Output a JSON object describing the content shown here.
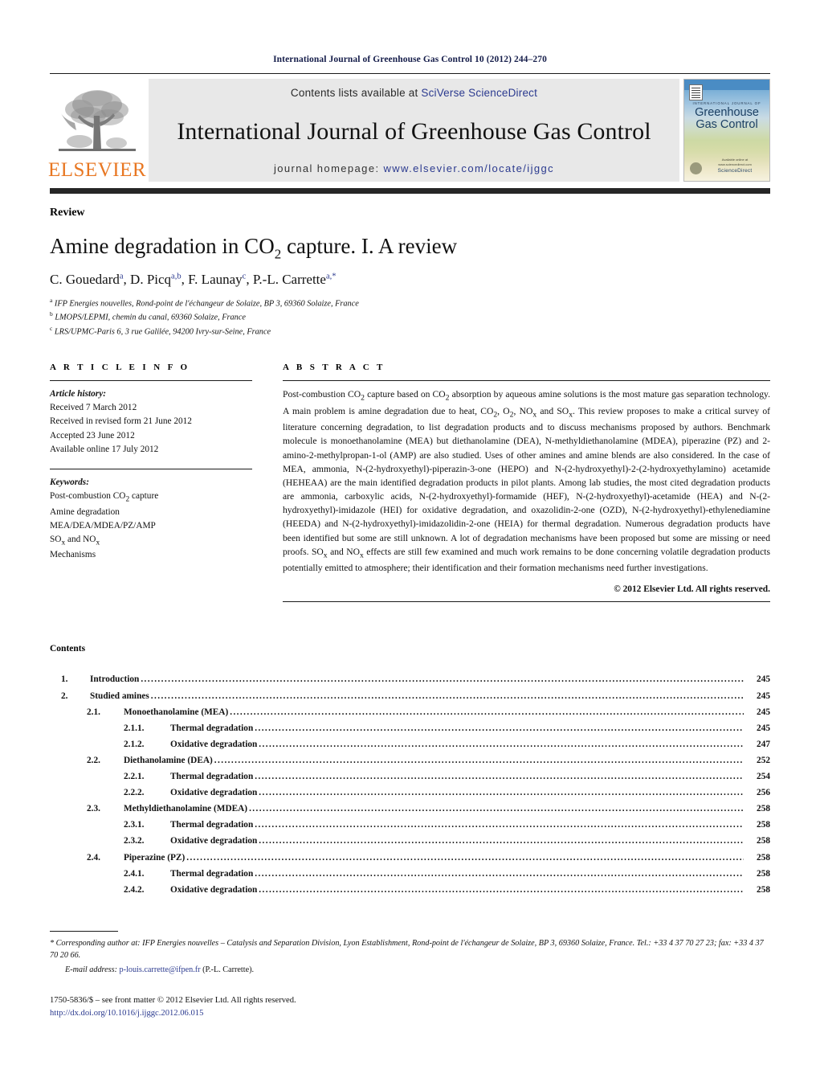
{
  "running_head": "International Journal of Greenhouse Gas Control 10 (2012) 244–270",
  "masthead": {
    "contents_prefix": "Contents lists available at ",
    "sciencedirect": "SciVerse ScienceDirect",
    "journal_title": "International Journal of Greenhouse Gas Control",
    "homepage_label": "journal homepage: ",
    "homepage_url": "www.elsevier.com/locate/ijggc",
    "elsevier_wordmark": "ELSEVIER",
    "elsevier_color": "#E87722",
    "link_color": "#2b3a8f",
    "cover": {
      "eyebrow": "INTERNATIONAL JOURNAL OF",
      "line1": "Greenhouse",
      "line2": "Gas Control",
      "footer_mark": "ScienceDirect",
      "footer_note": "Available online at www.sciencedirect.com"
    }
  },
  "article": {
    "doctype": "Review",
    "title_part1": "Amine degradation in CO",
    "title_sub": "2",
    "title_part2": " capture. I. A review",
    "authors_html": "C. Gouedard<sup>a</sup>, D. Picq<sup>a,b</sup>, F. Launay<sup>c</sup>, P.-L. Carrette<sup>a,*</sup>",
    "affiliations": [
      {
        "mark": "a",
        "text": "IFP Energies nouvelles, Rond-point de l'échangeur de Solaize, BP 3, 69360 Solaize, France"
      },
      {
        "mark": "b",
        "text": "LMOPS/LEPMI, chemin du canal, 69360 Solaize, France"
      },
      {
        "mark": "c",
        "text": "LRS/UPMC-Paris 6, 3 rue Galilée, 94200 Ivry-sur-Seine, France"
      }
    ]
  },
  "article_info": {
    "heading": "A R T I C L E   I N F O",
    "history_label": "Article history:",
    "history": [
      "Received 7 March 2012",
      "Received in revised form 21 June 2012",
      "Accepted 23 June 2012",
      "Available online 17 July 2012"
    ],
    "keywords_label": "Keywords:",
    "keywords": [
      "Post-combustion CO2 capture",
      "Amine degradation",
      "MEA/DEA/MDEA/PZ/AMP",
      "SOx and NOx",
      "Mechanisms"
    ]
  },
  "abstract": {
    "heading": "A B S T R A C T",
    "text": "Post-combustion CO2 capture based on CO2 absorption by aqueous amine solutions is the most mature gas separation technology. A main problem is amine degradation due to heat, CO2, O2, NOx and SOx. This review proposes to make a critical survey of literature concerning degradation, to list degradation products and to discuss mechanisms proposed by authors. Benchmark molecule is monoethanolamine (MEA) but diethanolamine (DEA), N-methyldiethanolamine (MDEA), piperazine (PZ) and 2-amino-2-methylpropan-1-ol (AMP) are also studied. Uses of other amines and amine blends are also considered. In the case of MEA, ammonia, N-(2-hydroxyethyl)-piperazin-3-one (HEPO) and N-(2-hydroxyethyl)-2-(2-hydroxyethylamino) acetamide (HEHEAA) are the main identified degradation products in pilot plants. Among lab studies, the most cited degradation products are ammonia, carboxylic acids, N-(2-hydroxyethyl)-formamide (HEF), N-(2-hydroxyethyl)-acetamide (HEA) and N-(2-hydroxyethyl)-imidazole (HEI) for oxidative degradation, and oxazolidin-2-one (OZD), N-(2-hydroxyethyl)-ethylenediamine (HEEDA) and N-(2-hydroxyethyl)-imidazolidin-2-one (HEIA) for thermal degradation. Numerous degradation products have been identified but some are still unknown. A lot of degradation mechanisms have been proposed but some are missing or need proofs. SOx and NOx effects are still few examined and much work remains to be done concerning volatile degradation products potentially emitted to atmosphere; their identification and their formation mechanisms need further investigations.",
    "copyright": "© 2012 Elsevier Ltd. All rights reserved."
  },
  "contents": {
    "heading": "Contents",
    "entries": [
      {
        "level": 1,
        "num": "1.",
        "title": "Introduction",
        "page": "245"
      },
      {
        "level": 1,
        "num": "2.",
        "title": "Studied amines",
        "page": "245"
      },
      {
        "level": 2,
        "num": "2.1.",
        "title": "Monoethanolamine (MEA)",
        "page": "245"
      },
      {
        "level": 3,
        "num": "2.1.1.",
        "title": "Thermal degradation",
        "page": "245"
      },
      {
        "level": 3,
        "num": "2.1.2.",
        "title": "Oxidative degradation",
        "page": "247"
      },
      {
        "level": 2,
        "num": "2.2.",
        "title": "Diethanolamine (DEA)",
        "page": "252"
      },
      {
        "level": 3,
        "num": "2.2.1.",
        "title": "Thermal degradation",
        "page": "254"
      },
      {
        "level": 3,
        "num": "2.2.2.",
        "title": "Oxidative degradation",
        "page": "256"
      },
      {
        "level": 2,
        "num": "2.3.",
        "title": "Methyldiethanolamine (MDEA)",
        "page": "258"
      },
      {
        "level": 3,
        "num": "2.3.1.",
        "title": "Thermal degradation",
        "page": "258"
      },
      {
        "level": 3,
        "num": "2.3.2.",
        "title": "Oxidative degradation",
        "page": "258"
      },
      {
        "level": 2,
        "num": "2.4.",
        "title": "Piperazine (PZ)",
        "page": "258"
      },
      {
        "level": 3,
        "num": "2.4.1.",
        "title": "Thermal degradation",
        "page": "258"
      },
      {
        "level": 3,
        "num": "2.4.2.",
        "title": "Oxidative degradation",
        "page": "258"
      }
    ]
  },
  "footnotes": {
    "corresponding": "* Corresponding author at: IFP Energies nouvelles – Catalysis and Separation Division, Lyon Establishment, Rond-point de l'échangeur de Solaize, BP 3, 69360 Solaize, France. Tel.: +33 4 37 70 27 23; fax: +33 4 37 70 20 66.",
    "email_label": "E-mail address:",
    "email": "p-louis.carrette@ifpen.fr",
    "email_attrib": "(P.-L. Carrette).",
    "issn_line": "1750-5836/$ – see front matter © 2012 Elsevier Ltd. All rights reserved.",
    "doi_line": "http://dx.doi.org/10.1016/j.ijggc.2012.06.015"
  }
}
